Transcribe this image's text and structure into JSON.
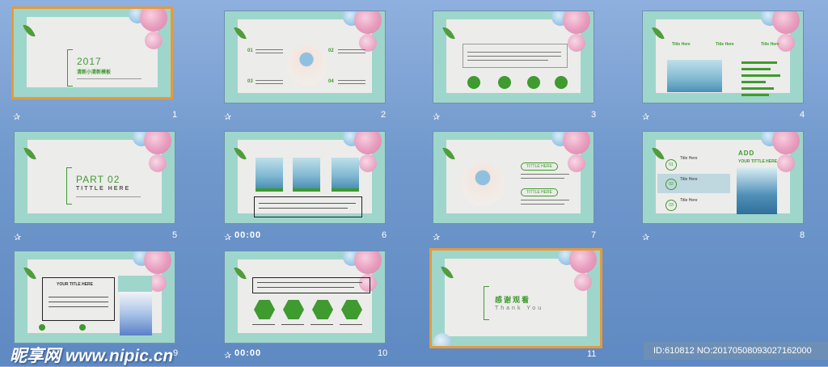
{
  "slides": [
    {
      "number": "1",
      "selected": true,
      "title": "2017",
      "subtitle": "清新小清新模板"
    },
    {
      "number": "2",
      "labels": [
        "01",
        "02",
        "03",
        "04"
      ]
    },
    {
      "number": "3"
    },
    {
      "number": "4",
      "headings": [
        "Title Here",
        "Title Here",
        "Title Here"
      ]
    },
    {
      "number": "5",
      "title": "PART 02",
      "subtitle": "TITTLE HERE"
    },
    {
      "number": "6",
      "time": "00:00"
    },
    {
      "number": "7",
      "buttons": [
        "TITTLE HERE",
        "TITTLE HERE"
      ]
    },
    {
      "number": "8",
      "title": "ADD",
      "subtitle": "YOUR TITTLE HERE",
      "labels": [
        "01",
        "02",
        "03"
      ],
      "items": [
        "Title Here",
        "Title Here",
        "Title Here"
      ]
    },
    {
      "number": "9",
      "heading": "YOUR TITLE HERE"
    },
    {
      "number": "10",
      "time": "00:00"
    },
    {
      "number": "11",
      "selected": true,
      "title": "感谢观看",
      "subtitle": "Thank You"
    }
  ],
  "watermark": "昵享网 www.nipic.cn",
  "image_id": "ID:610812 NO:20170508093027162000",
  "colors": {
    "accent_green": "#3f9a2f",
    "selection": "#e59a3c",
    "background": "#7098cc"
  }
}
